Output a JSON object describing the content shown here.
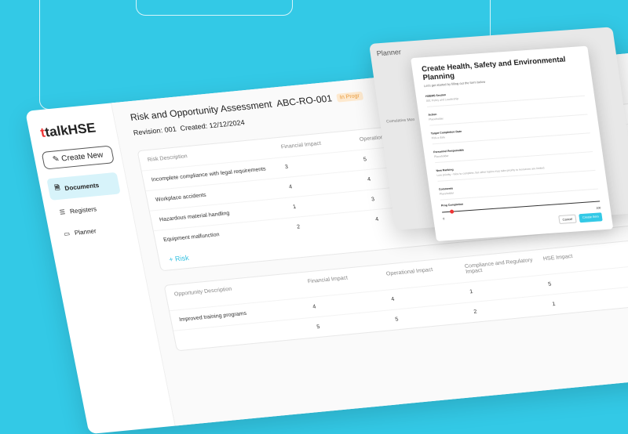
{
  "sidebar": {
    "logo": "talkHSE",
    "create": "Create New",
    "items": [
      "Documents",
      "Registers",
      "Planner"
    ]
  },
  "doc": {
    "title": "Risk and Opportunity Assessment",
    "code": "ABC-RO-001",
    "status": "In Progr",
    "revision": "Revision: 001",
    "created": "Created: 12/12/2024"
  },
  "risks": {
    "headers": [
      "Risk Description",
      "Financial Impact",
      "Operational"
    ],
    "rows": [
      [
        "Incomplete compliance with legal requirements",
        "3",
        "5"
      ],
      [
        "Workplace accidents",
        "4",
        "4"
      ],
      [
        "Hazardous material handling",
        "1",
        "3"
      ],
      [
        "Equipment malfunction",
        "2",
        "4"
      ]
    ],
    "add": "+ Risk"
  },
  "opps": {
    "headers": [
      "Opportunity Description",
      "Financial Impact",
      "Operational Impact",
      "Compliance and Regulatory Impact",
      "HSE Impact"
    ],
    "rows": [
      [
        "Improved training programs",
        "4",
        "4",
        "1",
        "5"
      ],
      [
        "",
        "5",
        "5",
        "2",
        "1"
      ]
    ]
  },
  "planner": {
    "title": "Planner",
    "side": [
      "Cumulative Mon"
    ]
  },
  "modal": {
    "title": "Create Health, Safety and Environmental Planning",
    "subtitle": "Let's get started by filling out the form below",
    "fields": [
      {
        "label": "HSEMS Section",
        "value": "001 Policy and Leadership"
      },
      {
        "label": "Action",
        "value": "Placeholder"
      },
      {
        "label": "Target Completion Date",
        "value": "Pick a date"
      },
      {
        "label": "Personnel Responsible",
        "value": "Placeholder"
      },
      {
        "label": "New Ranking",
        "value": "Low priority - Nice to complete, but other topics may take priority to resources are limited"
      },
      {
        "label": "Comments",
        "value": "Placeholder"
      }
    ],
    "progress_label": "Prog Completion",
    "progress_min": "0",
    "progress_max": "100",
    "progress_value": 5,
    "cancel": "Cancel",
    "create": "Create Item"
  }
}
